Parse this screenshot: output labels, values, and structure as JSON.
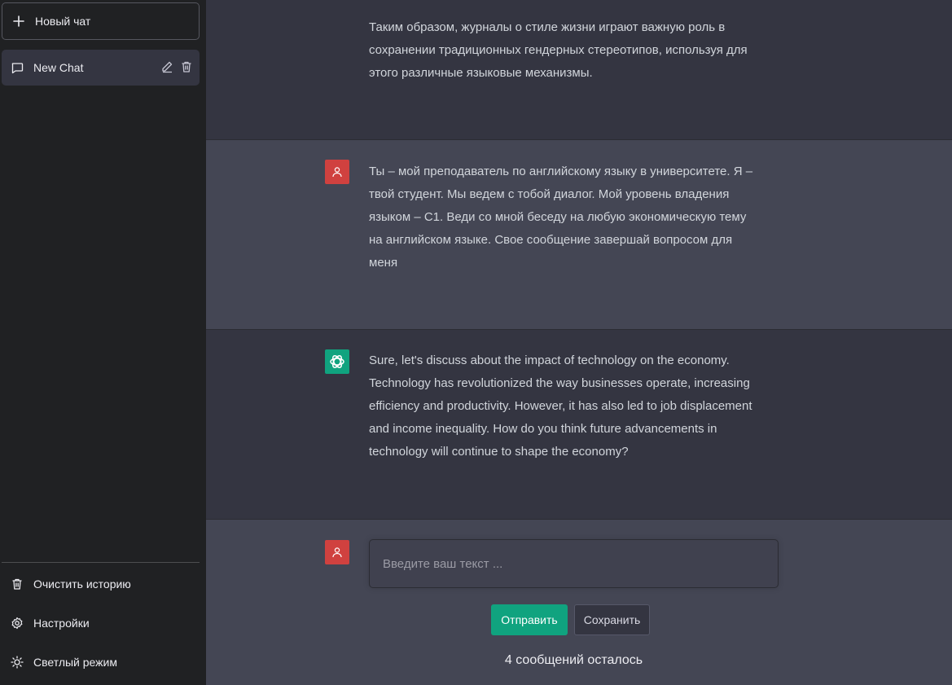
{
  "sidebar": {
    "new_chat_label": "Новый чат",
    "chat_items": [
      {
        "label": "New Chat"
      }
    ],
    "bottom_links": [
      {
        "label": "Очистить историю",
        "icon": "trash-icon"
      },
      {
        "label": "Настройки",
        "icon": "gear-icon"
      },
      {
        "label": "Светлый режим",
        "icon": "sun-icon"
      }
    ]
  },
  "messages": [
    {
      "role": "assistant",
      "text": "Таким образом, журналы о стиле жизни играют важную роль в\nсохранении традиционных гендерных стереотипов, используя для\nэтого различные языковые механизмы."
    },
    {
      "role": "user",
      "text": "Ты – мой преподаватель по английскому языку в университете. Я –\nтвой студент. Мы ведем с тобой диалог. Мой уровень владения\nязыком – C1. Веди со мной беседу на любую экономическую тему\nна английском языке. Свое сообщение завершай вопросом для\nменя"
    },
    {
      "role": "assistant",
      "text": "Sure, let's discuss about the impact of technology on the economy.\nTechnology has revolutionized the way businesses operate, increasing\nefficiency and productivity. However, it has also led to job displacement\nand income inequality. How do you think future advancements in\ntechnology will continue to shape the economy?"
    }
  ],
  "composer": {
    "placeholder": "Введите ваш текст ...",
    "value": "",
    "send_label": "Отправить",
    "save_label": "Сохранить",
    "remaining_text": "4 сообщений осталось"
  },
  "colors": {
    "sidebar_bg": "#202123",
    "assistant_bg": "#343541",
    "user_bg": "#444654",
    "accent_green": "#10a37f",
    "user_avatar_red": "#d0413f"
  }
}
